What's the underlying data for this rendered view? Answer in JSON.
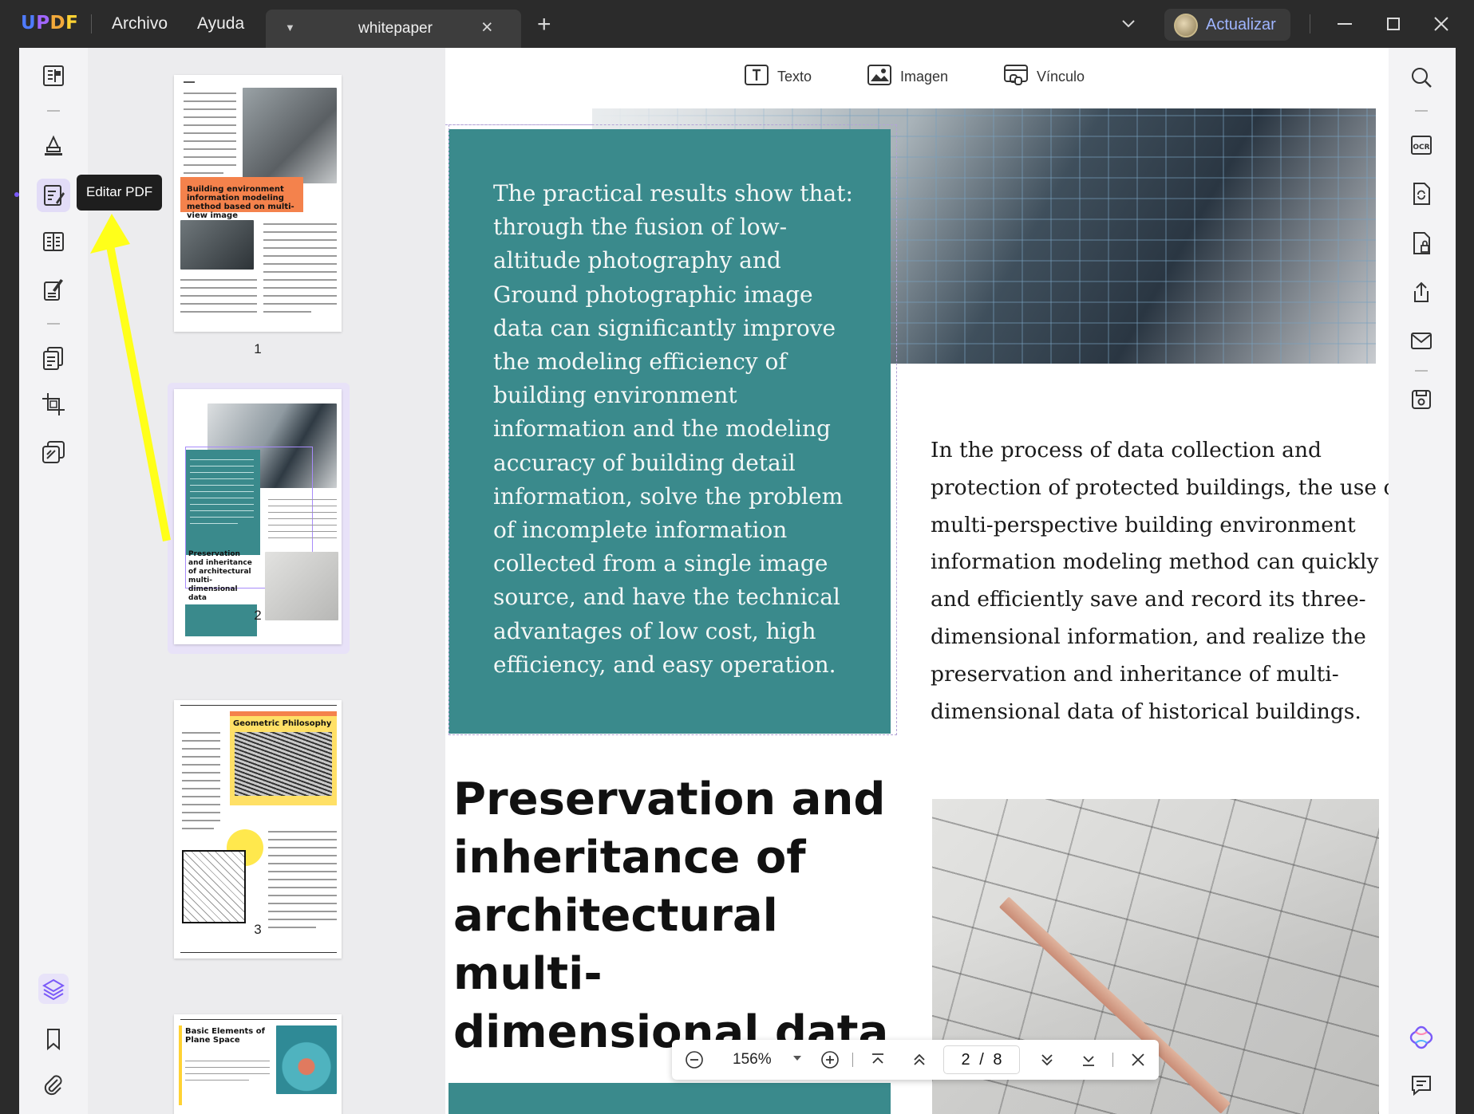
{
  "app": {
    "logo": "UPDF",
    "menus": [
      "Archivo",
      "Ayuda"
    ],
    "tab_title": "whitepaper",
    "upgrade_label": "Actualizar"
  },
  "tooltip": "Editar PDF",
  "edit_toolbar": {
    "text_label": "Texto",
    "image_label": "Imagen",
    "link_label": "Vínculo"
  },
  "thumbnails": [
    {
      "number": "1",
      "label": "Building environment information modeling method based on multi-view image"
    },
    {
      "number": "2",
      "label": "Preservation and inheritance of architectural multi-dimensional data"
    },
    {
      "number": "3",
      "label": "Geometric Philosophy"
    },
    {
      "number": "",
      "label": "Basic Elements of Plane Space"
    }
  ],
  "document": {
    "teal_paragraph": "The practical results show that: through the fusion of low-altitude photography and Ground photographic image data can significantly improve the modeling efficiency of building environment information and the modeling accuracy of building detail information, solve the problem of incomplete information collected from a single image source, and have the technical advantages of low cost, high efficiency, and easy operation.",
    "body_lines": [
      "In the process of data collection and",
      "protection of protected buildings, the use of",
      "multi-perspective building environment",
      "information modeling method can quickly",
      "and efficiently save and record its three-",
      "dimensional information, and realize the",
      "preservation and inheritance of multi-",
      "dimensional data of historical buildings."
    ],
    "heading": "Preservation and inheritance of architectural multi-dimensional data"
  },
  "zoom": {
    "level": "156%",
    "current_page": "2",
    "separator": "/",
    "total_pages": "8"
  }
}
